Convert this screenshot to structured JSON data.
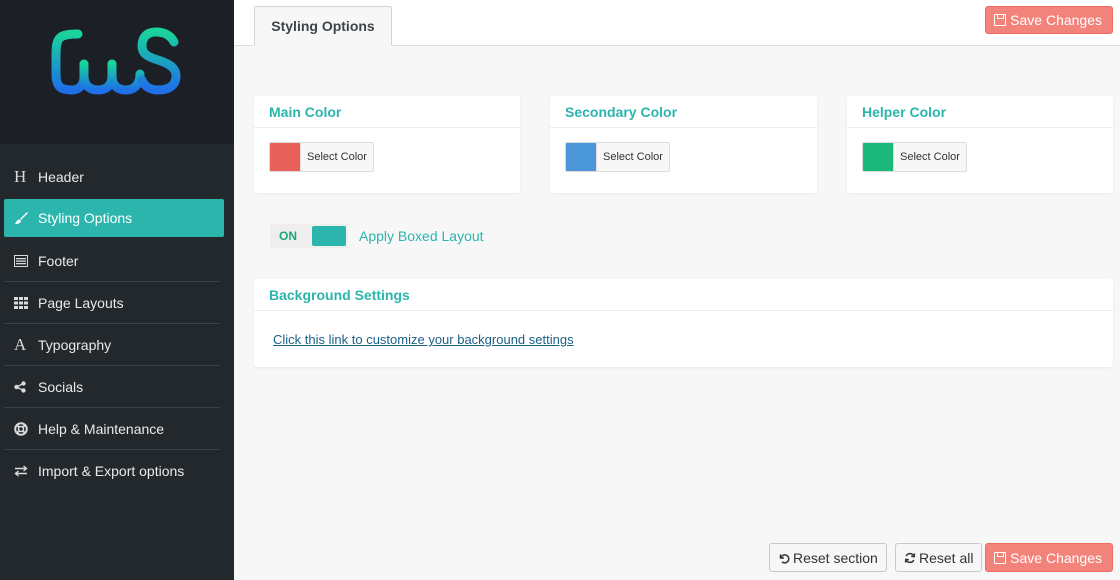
{
  "sidebar": {
    "logo": {
      "text": "CWS",
      "icon": "cws-logo",
      "colors": [
        "#19c7a6",
        "#1e88e5"
      ]
    },
    "items": [
      {
        "label": "Header",
        "icon": "header-icon",
        "glyph": "H"
      },
      {
        "label": "Styling Options",
        "icon": "brush-icon",
        "active": true
      },
      {
        "label": "Footer",
        "icon": "footer-icon"
      },
      {
        "label": "Page Layouts",
        "icon": "grid-icon"
      },
      {
        "label": "Typography",
        "icon": "typography-icon",
        "glyph": "A"
      },
      {
        "label": "Socials",
        "icon": "share-icon"
      },
      {
        "label": "Help & Maintenance",
        "icon": "lifebuoy-icon"
      },
      {
        "label": "Import & Export options",
        "icon": "exchange-icon"
      }
    ]
  },
  "header": {
    "tab_label": "Styling Options",
    "save_label": "Save Changes"
  },
  "colors": {
    "main": {
      "title": "Main Color",
      "value": "#e8605a",
      "button_label": "Select Color"
    },
    "secondary": {
      "title": "Secondary Color",
      "value": "#4a96d9",
      "button_label": "Select Color"
    },
    "helper": {
      "title": "Helper Color",
      "value": "#1ab87a",
      "button_label": "Select Color"
    }
  },
  "boxed_layout": {
    "state_label": "ON",
    "label": "Apply Boxed Layout"
  },
  "background": {
    "title": "Background Settings",
    "link_text": "Click this link to customize your background settings"
  },
  "footer": {
    "reset_section_label": "Reset section",
    "reset_all_label": "Reset all",
    "save_label": "Save Changes"
  },
  "theme": {
    "accent": "#2bb5ad",
    "sidebar_bg": "#23282d",
    "save_button": "#f2837a"
  }
}
